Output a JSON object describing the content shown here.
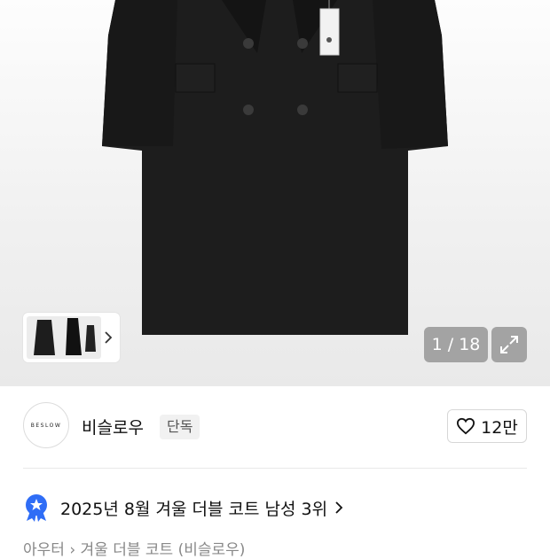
{
  "gallery": {
    "counter": "1 / 18",
    "expand_icon": "expand-icon",
    "thumbnail_next_icon": "chevron-right-icon"
  },
  "brand": {
    "logo_text": "BESLOW",
    "name": "비슬로우",
    "badge": "단독",
    "like_icon": "heart-icon",
    "like_count": "12만"
  },
  "ranking": {
    "icon": "rank-badge-icon",
    "text": "2025년 8월 겨울 더블 코트 남성 3위"
  },
  "breadcrumb": {
    "text": "아우터 › 겨울 더블 코트 (비슬로우)"
  },
  "colors": {
    "accent_blue": "#2f6df6",
    "coat": "#1b1b1b"
  }
}
